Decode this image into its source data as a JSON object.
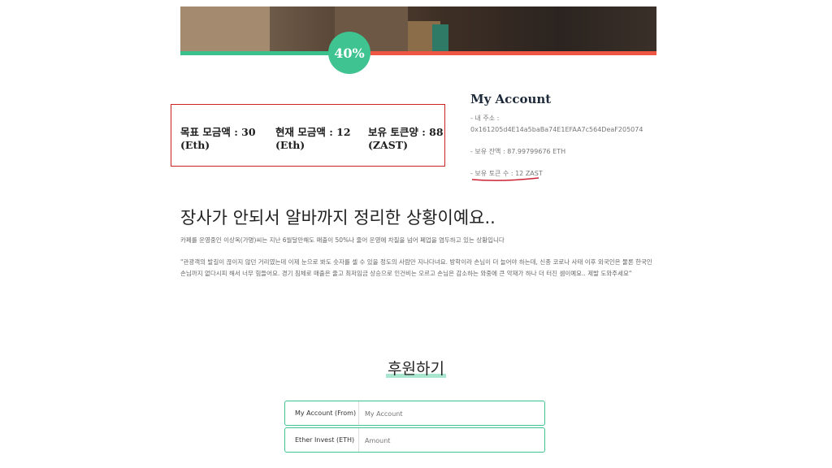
{
  "campaign": {
    "progress_label": "40%",
    "progress_fraction": 0.4,
    "stats": [
      {
        "line1": "목표 모금액 : 30",
        "line2": "(Eth)"
      },
      {
        "line1": "현재 모금액 : 12",
        "line2": "(Eth)"
      },
      {
        "line1": "보유 토큰양 : 88",
        "line2": "(ZAST)"
      }
    ],
    "headline": "장사가 안되서 알바까지 정리한 상황이예요..",
    "summary": "카페를 운영중인 이상옥(가명)씨는 지난 6월달만해도 매출이 50%나 줄어 운영에 차질을 넘어 폐업을 염두하고 있는 상황입니다",
    "quote": "\"관광객의 발길이 끊이지 않던 거리였는데 이제 눈으로 봐도 숫자를 셀 수 있을 정도의 사람만 지나다녀요. 방학이라 손님이 더 늘어야 하는데, 신종 코로나 사태 이후 외국인은 물론 한국인 손님까지 없다시피 해서 너무 힘들어요. 경기 침체로 매출은 줄고 최저임금 상승으로 인건비는 오르고 손님은 감소하는 와중에 큰 악재가 하나 더 터진 셈이예요.. 제발 도와주세요\""
  },
  "account": {
    "title": "My Account",
    "address_label": "- 내 주소 :",
    "address": "0x161205d4E14a5baBa74E1EFAA7c564DeaF205074",
    "balance": "- 보유 잔액 : 87.99799676 ETH",
    "tokens": "- 보유 토큰 수 : 12 ZAST"
  },
  "donate": {
    "title": "후원하기",
    "rows": [
      {
        "label": "My Account (From)",
        "placeholder": "My Account"
      },
      {
        "label": "Ether Invest (ETH)",
        "placeholder": "Amount"
      }
    ]
  },
  "colors": {
    "progress_done": "#39c08d",
    "progress_rest": "#ee5544",
    "accent": "#3fc491",
    "highlight_box": "#cc2222"
  }
}
